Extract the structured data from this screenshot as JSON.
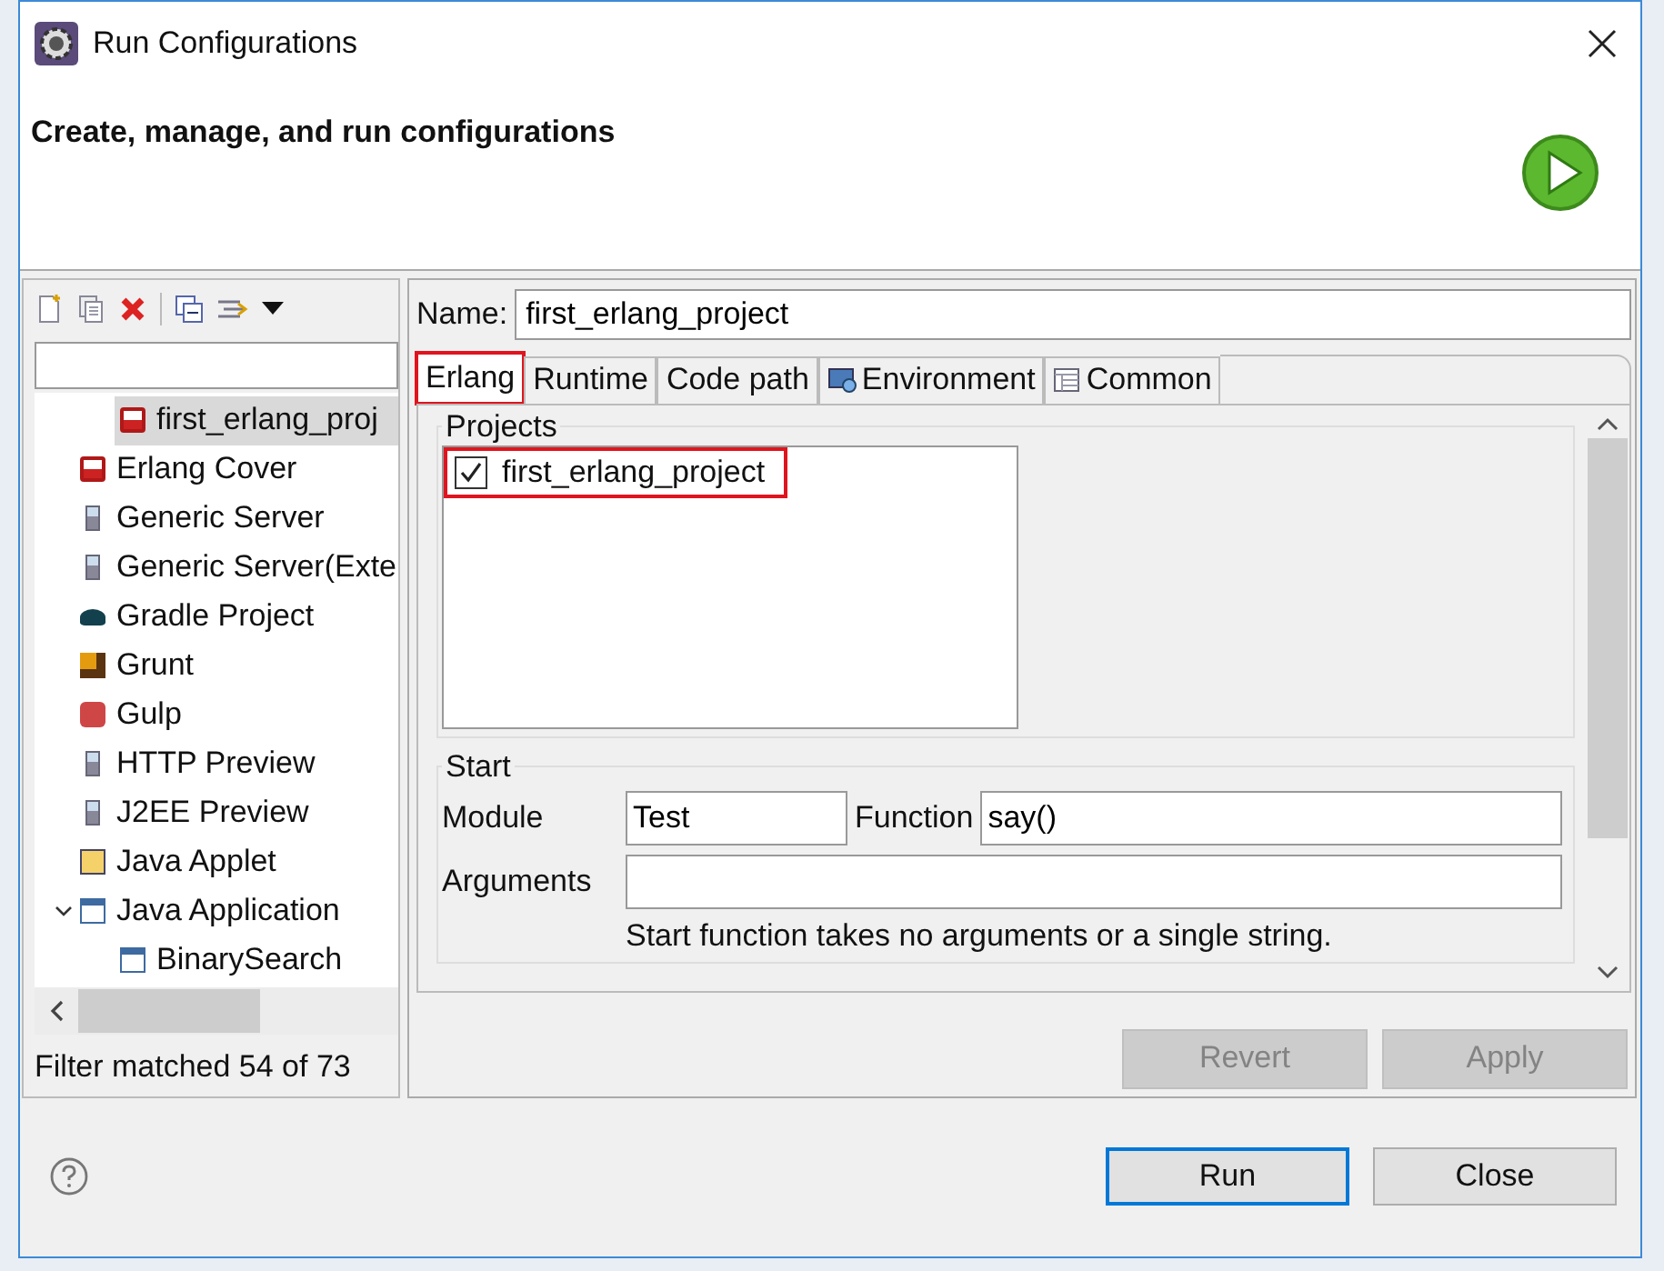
{
  "window": {
    "title": "Run Configurations"
  },
  "header": {
    "title": "Create, manage, and run configurations"
  },
  "sidebar": {
    "scrolled_parent_children": [
      {
        "label": "first_erlang_proj",
        "kind": "erlang",
        "selected": true
      }
    ],
    "items": [
      {
        "label": "Erlang Cover",
        "kind": "erlang",
        "selected": false
      },
      {
        "label": "Generic Server",
        "kind": "server",
        "selected": false
      },
      {
        "label": "Generic Server(Exte",
        "kind": "server",
        "selected": false
      },
      {
        "label": "Gradle Project",
        "kind": "gradle",
        "selected": false
      },
      {
        "label": "Grunt",
        "kind": "grunt",
        "selected": false
      },
      {
        "label": "Gulp",
        "kind": "gulp",
        "selected": false
      },
      {
        "label": "HTTP Preview",
        "kind": "server",
        "selected": false
      },
      {
        "label": "J2EE Preview",
        "kind": "server",
        "selected": false
      },
      {
        "label": "Java Applet",
        "kind": "applet",
        "selected": false
      },
      {
        "label": "Java Application",
        "kind": "javaapp",
        "selected": false,
        "expanded": true,
        "children": [
          {
            "label": "BinarySearch",
            "kind": "javaapp",
            "selected": false
          }
        ]
      }
    ],
    "status": "Filter matched 54 of 73"
  },
  "name_field": {
    "label": "Name:",
    "value": "first_erlang_project"
  },
  "tabs": [
    {
      "label": "Erlang",
      "kind": "plain",
      "selected": true,
      "highlighted": true
    },
    {
      "label": "Runtime",
      "kind": "plain",
      "selected": false,
      "highlighted": false
    },
    {
      "label": "Code path",
      "kind": "plain",
      "selected": false,
      "highlighted": false
    },
    {
      "label": "Environment",
      "kind": "environment",
      "selected": false,
      "highlighted": false
    },
    {
      "label": "Common",
      "kind": "common",
      "selected": false,
      "highlighted": false
    }
  ],
  "projects": {
    "title": "Projects",
    "items": [
      {
        "label": "first_erlang_project",
        "checked": true,
        "highlighted": true
      }
    ]
  },
  "start": {
    "title": "Start",
    "module_label": "Module",
    "module": "Test",
    "function_label": "Function",
    "function": "say()",
    "arguments_label": "Arguments",
    "hint": "Start function takes no arguments or a single string."
  },
  "panel_buttons": [
    {
      "label": "Revert",
      "disabled": true
    },
    {
      "label": "Apply",
      "disabled": true
    }
  ],
  "dialog_buttons": [
    {
      "label": "Run",
      "default": true
    },
    {
      "label": "Close",
      "default": false
    }
  ]
}
